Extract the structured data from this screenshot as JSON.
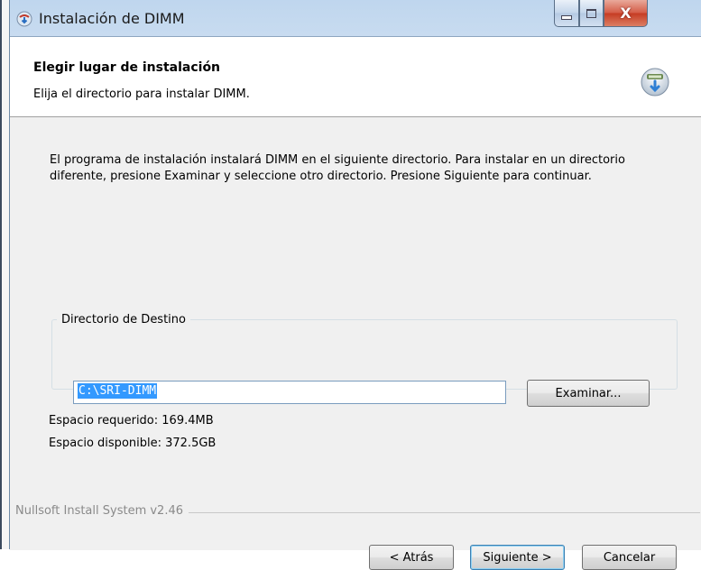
{
  "window": {
    "title": "Instalación de DIMM",
    "close_glyph": "X"
  },
  "header": {
    "title": "Elegir lugar de instalación",
    "subtitle": "Elija el directorio para instalar DIMM."
  },
  "body": {
    "description": "El programa de instalación instalará DIMM en el siguiente directorio. Para instalar en un directorio diferente, presione Examinar y seleccione otro directorio. Presione Siguiente para continuar."
  },
  "destination": {
    "group_label": "Directorio de Destino",
    "path": "C:\\SRI-DIMM",
    "browse_label": "Examinar..."
  },
  "space": {
    "required": "Espacio requerido: 169.4MB",
    "available": "Espacio disponible: 372.5GB"
  },
  "footer": {
    "brand": "Nullsoft Install System v2.46",
    "back_label": "< Atrás",
    "next_label": "Siguiente >",
    "cancel_label": "Cancelar"
  },
  "colors": {
    "title_bar": "#c9dcf0",
    "selection": "#3399ff",
    "close_button": "#c53b22"
  },
  "icons": {
    "title": "installer-icon",
    "header": "nsis-install-icon"
  }
}
